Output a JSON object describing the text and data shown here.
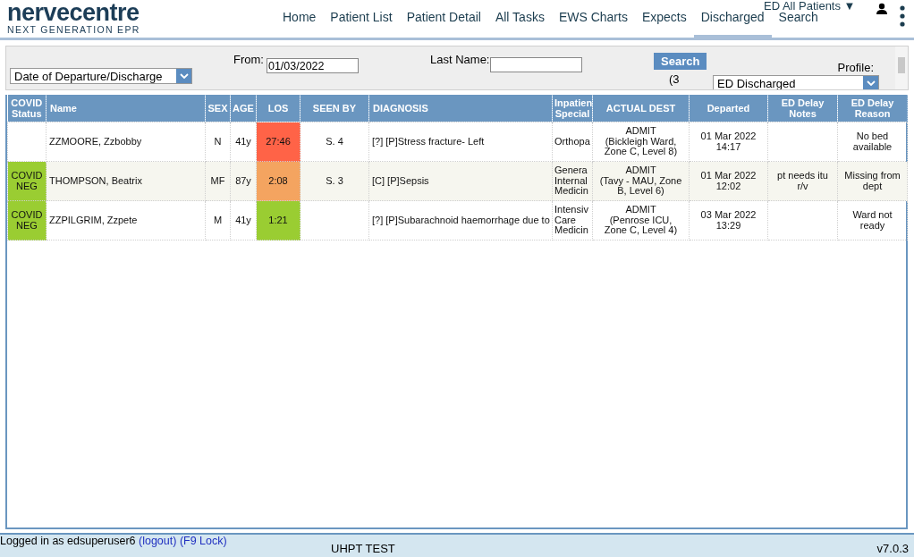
{
  "logo": {
    "name": "nervecentre",
    "tagline": "NEXT GENERATION EPR"
  },
  "nav": [
    {
      "label": "Home",
      "selected": false
    },
    {
      "label": "Patient List",
      "selected": false
    },
    {
      "label": "Patient Detail",
      "selected": false
    },
    {
      "label": "All Tasks",
      "selected": false
    },
    {
      "label": "EWS Charts",
      "selected": false
    },
    {
      "label": "Expects",
      "selected": false
    },
    {
      "label": "Discharged",
      "selected": true
    },
    {
      "label": "Search",
      "selected": false
    }
  ],
  "view_menu": {
    "label": "ED All Patients",
    "caret": "▼"
  },
  "filter": {
    "date_type": "Date of Departure/Discharge",
    "from_label": "From:",
    "from_value": "01/03/2022",
    "last_name_label": "Last Name:",
    "search_button": "Search",
    "count": "(3",
    "profile_label": "Profile:",
    "profile_value": "ED Discharged"
  },
  "table": {
    "columns": [
      "COVID Status",
      "Name",
      "SEX",
      "AGE",
      "LOS",
      "SEEN BY",
      "DIAGNOSIS",
      "Inpatien Special",
      "ACTUAL DEST",
      "Departed",
      "ED Delay Notes",
      "ED Delay Reason"
    ],
    "rows": [
      {
        "covid": null,
        "name": "ZZMOORE, Zzbobby",
        "sex": "N",
        "age": "41y",
        "los": {
          "text": "27:46",
          "color": "#ff6347"
        },
        "seen_by": "S. 4",
        "diagnosis": "[?] [P]Stress fracture- Left",
        "specialty": "Orthopa",
        "dest_type": "ADMIT",
        "dest_location": "(Bickleigh Ward, Zone C, Level 8)",
        "departed": "01 Mar 2022 14:17",
        "notes": null,
        "reason": "No bed available"
      },
      {
        "covid": {
          "text": "COVID NEG",
          "color": "#9acd32"
        },
        "name": "THOMPSON, Beatrix",
        "sex": "MF",
        "age": "87y",
        "los": {
          "text": "2:08",
          "color": "#f4a460"
        },
        "seen_by": "S. 3",
        "diagnosis": "[C] [P]Sepsis",
        "specialty": "Genera Internal Medicin",
        "dest_type": "ADMIT",
        "dest_location": "(Tavy - MAU, Zone B, Level 6)",
        "departed": "01 Mar 2022 12:02",
        "notes": "pt needs itu r/v",
        "reason": "Missing from dept"
      },
      {
        "covid": {
          "text": "COVID NEG",
          "color": "#9acd32"
        },
        "name": "ZZPILGRIM, Zzpete",
        "sex": "M",
        "age": "41y",
        "los": {
          "text": "1:21",
          "color": "#9acd32"
        },
        "seen_by": null,
        "diagnosis": "[?] [P]Subarachnoid haemorrhage due to",
        "specialty": "Intensiv Care Medicin",
        "dest_type": "ADMIT",
        "dest_location": "(Penrose ICU, Zone C, Level 4)",
        "departed": "03 Mar 2022 13:29",
        "notes": null,
        "reason": "Ward not ready"
      }
    ]
  },
  "status_bar": {
    "login_text": "Logged in as edsuperuser6",
    "logout_link": "(logout)",
    "lock_link": "(F9 Lock)",
    "environment": "UHPT TEST",
    "version": "v7.0.3"
  }
}
